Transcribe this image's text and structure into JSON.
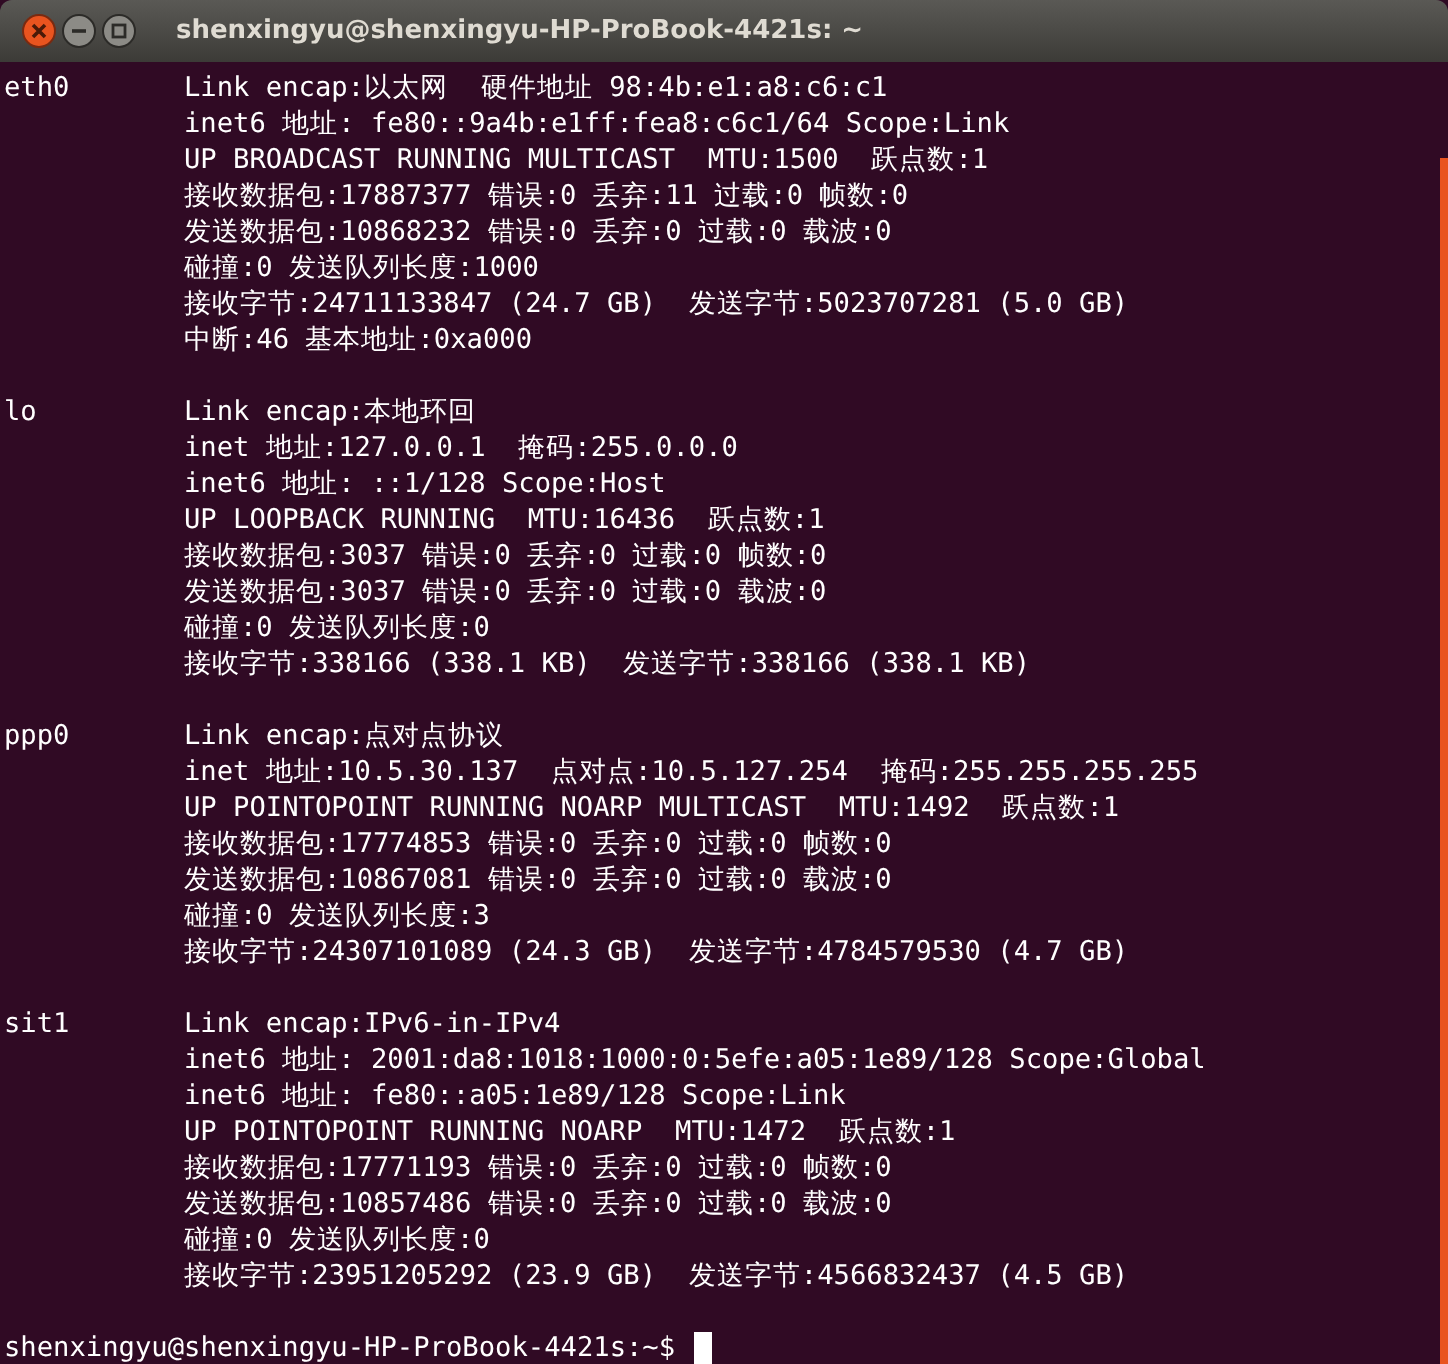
{
  "window": {
    "title": "shenxingyu@shenxingyu-HP-ProBook-4421s: ~"
  },
  "interfaces": [
    {
      "name": "eth0",
      "lines": [
        "Link encap:以太网  硬件地址 98:4b:e1:a8:c6:c1",
        "inet6 地址: fe80::9a4b:e1ff:fea8:c6c1/64 Scope:Link",
        "UP BROADCAST RUNNING MULTICAST  MTU:1500  跃点数:1",
        "接收数据包:17887377 错误:0 丢弃:11 过载:0 帧数:0",
        "发送数据包:10868232 错误:0 丢弃:0 过载:0 载波:0",
        "碰撞:0 发送队列长度:1000",
        "接收字节:24711133847 (24.7 GB)  发送字节:5023707281 (5.0 GB)",
        "中断:46 基本地址:0xa000"
      ]
    },
    {
      "name": "lo",
      "lines": [
        "Link encap:本地环回",
        "inet 地址:127.0.0.1  掩码:255.0.0.0",
        "inet6 地址: ::1/128 Scope:Host",
        "UP LOOPBACK RUNNING  MTU:16436  跃点数:1",
        "接收数据包:3037 错误:0 丢弃:0 过载:0 帧数:0",
        "发送数据包:3037 错误:0 丢弃:0 过载:0 载波:0",
        "碰撞:0 发送队列长度:0",
        "接收字节:338166 (338.1 KB)  发送字节:338166 (338.1 KB)"
      ]
    },
    {
      "name": "ppp0",
      "lines": [
        "Link encap:点对点协议",
        "inet 地址:10.5.30.137  点对点:10.5.127.254  掩码:255.255.255.255",
        "UP POINTOPOINT RUNNING NOARP MULTICAST  MTU:1492  跃点数:1",
        "接收数据包:17774853 错误:0 丢弃:0 过载:0 帧数:0",
        "发送数据包:10867081 错误:0 丢弃:0 过载:0 载波:0",
        "碰撞:0 发送队列长度:3",
        "接收字节:24307101089 (24.3 GB)  发送字节:4784579530 (4.7 GB)"
      ]
    },
    {
      "name": "sit1",
      "lines": [
        "Link encap:IPv6-in-IPv4",
        "inet6 地址: 2001:da8:1018:1000:0:5efe:a05:1e89/128 Scope:Global",
        "inet6 地址: fe80::a05:1e89/128 Scope:Link",
        "UP POINTOPOINT RUNNING NOARP  MTU:1472  跃点数:1",
        "接收数据包:17771193 错误:0 丢弃:0 过载:0 帧数:0",
        "发送数据包:10857486 错误:0 丢弃:0 过载:0 载波:0",
        "碰撞:0 发送队列长度:0",
        "接收字节:23951205292 (23.9 GB)  发送字节:4566832437 (4.5 GB)"
      ]
    }
  ],
  "prompt": "shenxingyu@shenxingyu-HP-ProBook-4421s:~$"
}
